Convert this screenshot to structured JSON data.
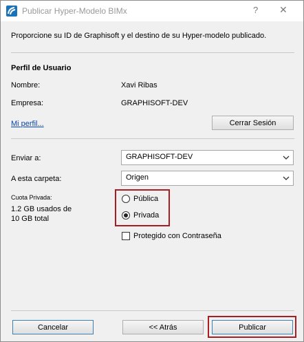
{
  "window": {
    "title": "Publicar Hyper-Modelo BIMx",
    "help": "?",
    "close": "✕"
  },
  "intro": "Proporcione su ID de Graphisoft y el destino de su Hyper-modelo publicado.",
  "profile": {
    "heading": "Perfil de Usuario",
    "name_label": "Nombre:",
    "name_value": "Xavi Ribas",
    "company_label": "Empresa:",
    "company_value": "GRAPHISOFT-DEV",
    "my_profile_link": "Mi perfil...",
    "logout_button": "Cerrar Sesión"
  },
  "destination": {
    "send_label": "Enviar a:",
    "send_value": "GRAPHISOFT-DEV",
    "folder_label": "A esta carpeta:",
    "folder_value": "Origen"
  },
  "quota": {
    "label": "Cuota Privada:",
    "used": "1.2 GB usados de",
    "total": "10 GB total"
  },
  "visibility": {
    "public_label": "Pública",
    "private_label": "Privada",
    "selected": "Privada"
  },
  "password": {
    "label": "Protegido con Contraseña",
    "checked": false
  },
  "footer": {
    "cancel": "Cancelar",
    "back": "<< Atrás",
    "publish": "Publicar"
  },
  "colors": {
    "highlight": "#a81d24",
    "link": "#0645ad",
    "focus": "#3c7fb1"
  }
}
